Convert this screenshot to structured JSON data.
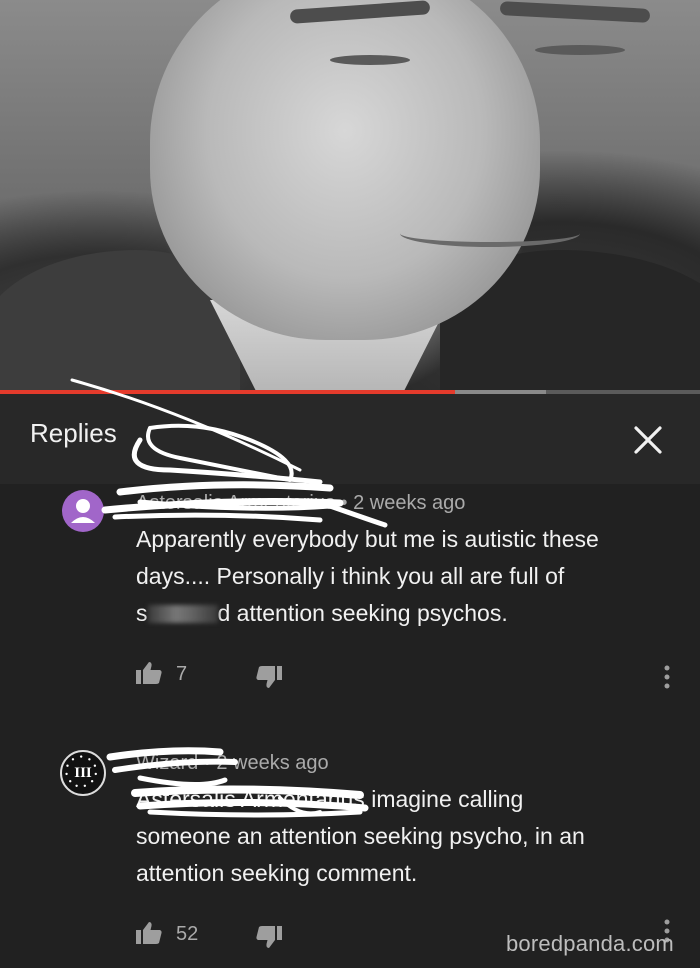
{
  "video": {
    "progress_fraction": 0.65,
    "buffer_fraction": 0.78,
    "progress_color": "#e53b2c"
  },
  "header": {
    "title": "Replies",
    "close_icon": "close-icon"
  },
  "comments": [
    {
      "author_visible": "Astersalis Armentarius",
      "separator": "•",
      "time": "2 weeks ago",
      "avatar_color": "#a166c9",
      "avatar_icon": "person-icon",
      "text_line1": "Apparently everybody but me is autistic these",
      "text_line2": "days.... Personally i think you all are full of",
      "text_line3_start": "s",
      "text_line3_end": "d attention seeking psychos.",
      "likes": "7"
    },
    {
      "author_visible": "Wizard",
      "separator": "•",
      "time": "2 weeks ago",
      "avatar_glyph": "III",
      "mention": "Astersalis Armentarius",
      "text_rest": " imagine calling",
      "text_line2": "someone an attention seeking psycho, in an",
      "text_line3": "attention seeking comment.",
      "likes": "52"
    }
  ],
  "watermark": "boredpanda.com"
}
